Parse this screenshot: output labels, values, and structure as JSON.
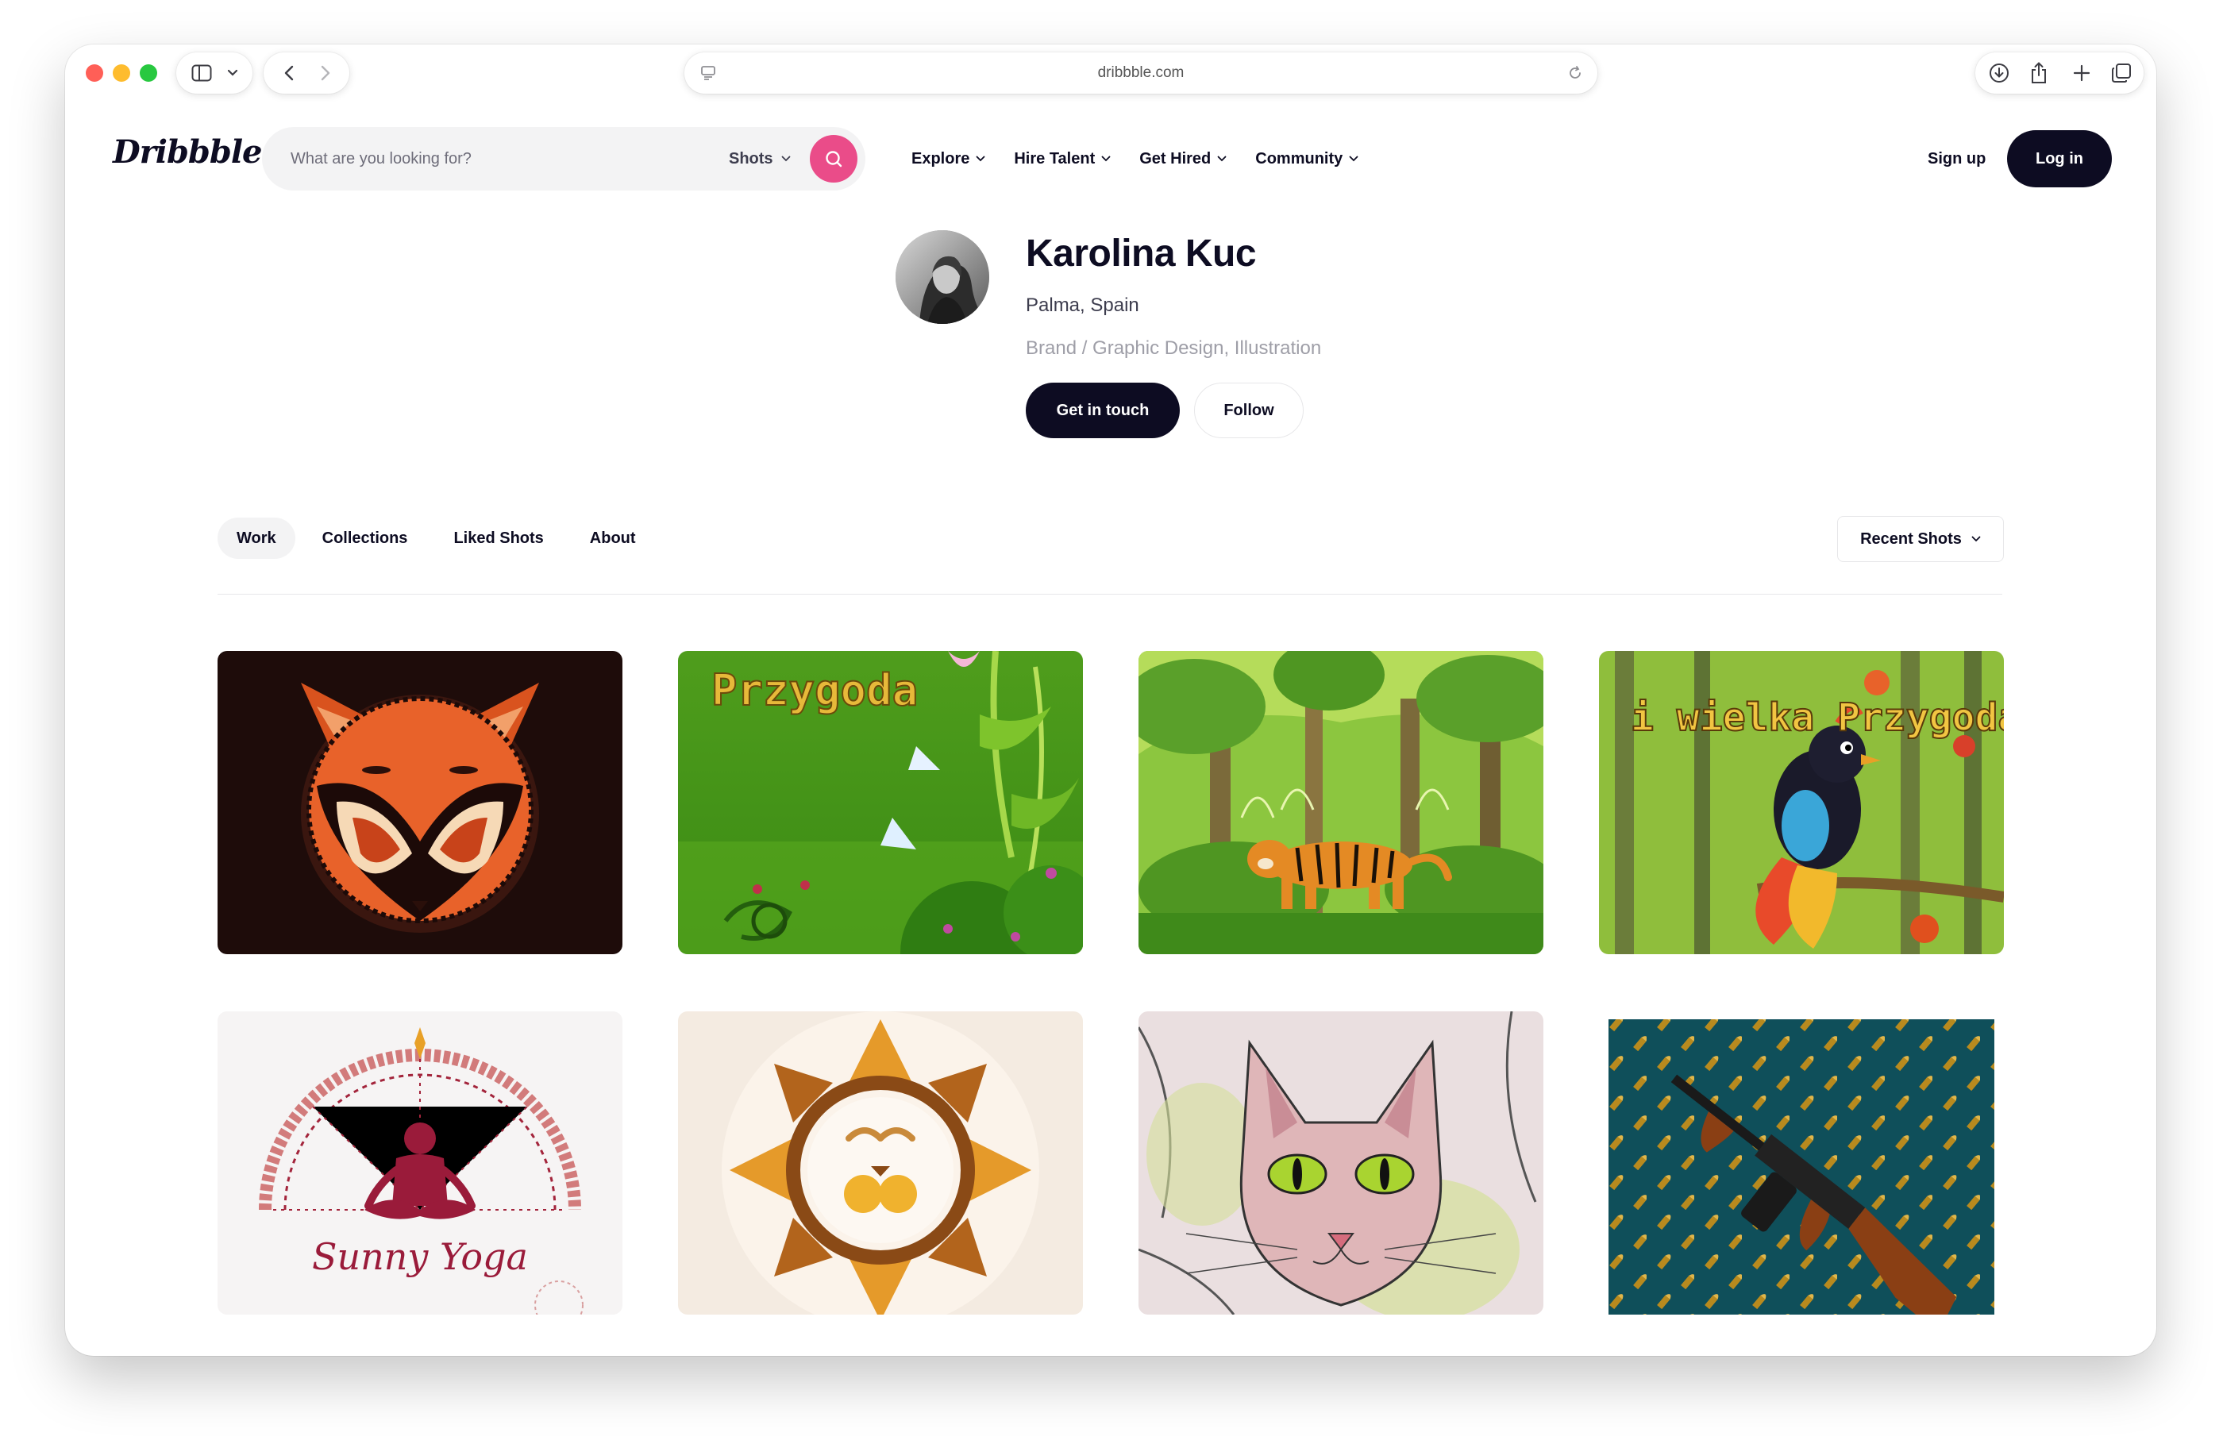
{
  "browser": {
    "url": "dribbble.com",
    "icons": [
      "sidebar-icon",
      "chevron-down-icon",
      "back-icon",
      "forward-icon",
      "page-settings-icon",
      "reload-icon",
      "download-icon",
      "share-icon",
      "new-tab-icon",
      "tabs-overview-icon"
    ]
  },
  "header": {
    "logo": "Dribbble",
    "search_placeholder": "What are you looking for?",
    "search_scope": "Shots",
    "nav": [
      "Explore",
      "Hire Talent",
      "Get Hired",
      "Community"
    ],
    "signup": "Sign up",
    "login": "Log in"
  },
  "profile": {
    "name": "Karolina Kuc",
    "location": "Palma, Spain",
    "skills": "Brand / Graphic Design, Illustration",
    "get_in_touch": "Get in touch",
    "follow": "Follow"
  },
  "tabs": {
    "items": [
      "Work",
      "Collections",
      "Liked Shots",
      "About"
    ],
    "active": "Work",
    "sort": "Recent Shots"
  },
  "shots": [
    {
      "name": "fox-logo",
      "text": ""
    },
    {
      "name": "przygoda-title",
      "text": "Przygoda"
    },
    {
      "name": "tiger-jungle",
      "text": ""
    },
    {
      "name": "bird-wielka-przygoda",
      "text": "i wielka Przygoda"
    },
    {
      "name": "sunny-yoga-logo",
      "text": "Sunny Yoga"
    },
    {
      "name": "sun-mandala",
      "text": ""
    },
    {
      "name": "sphynx-cat",
      "text": ""
    },
    {
      "name": "tommy-gun-pattern",
      "text": ""
    }
  ],
  "colors": {
    "accent": "#ea4c89",
    "dark": "#0d0c22",
    "muted": "#6e6d7a"
  }
}
